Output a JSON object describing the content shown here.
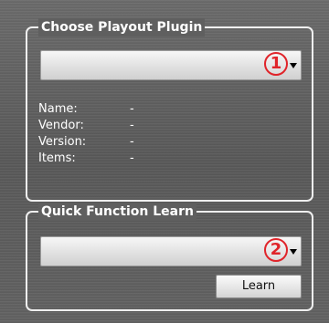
{
  "playout_group": {
    "title": "Choose Playout Plugin",
    "dropdown_value": "",
    "badge": "1",
    "info": [
      {
        "label": "Name:",
        "value": "-"
      },
      {
        "label": "Vendor:",
        "value": "-"
      },
      {
        "label": "Version:",
        "value": "-"
      },
      {
        "label": "Items:",
        "value": "-"
      }
    ]
  },
  "quick_group": {
    "title": "Quick Function Learn",
    "dropdown_value": "",
    "badge": "2",
    "learn_label": "Learn"
  },
  "colors": {
    "background": "#5e5e5e",
    "border": "#efefef",
    "badge": "#e0242a",
    "text": "#ffffff"
  },
  "icons": {
    "dropdown_arrow": "chevron-down-icon"
  }
}
